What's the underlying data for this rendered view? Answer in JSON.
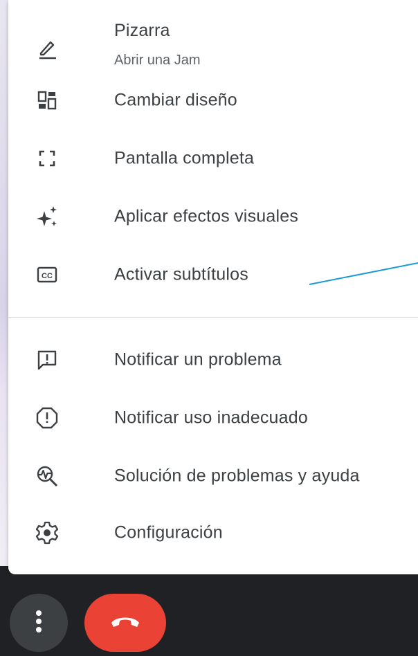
{
  "menu": {
    "items": [
      {
        "label": "Pizarra",
        "sublabel": "Abrir una Jam",
        "icon": "pencil-icon"
      },
      {
        "label": "Cambiar diseño",
        "icon": "layout-icon"
      },
      {
        "label": "Pantalla completa",
        "icon": "fullscreen-icon"
      },
      {
        "label": "Aplicar efectos visuales",
        "icon": "sparkle-icon"
      },
      {
        "label": "Activar subtítulos",
        "icon": "closed-captions-icon"
      },
      {
        "label": "Notificar un problema",
        "icon": "feedback-icon"
      },
      {
        "label": "Notificar uso inadecuado",
        "icon": "report-icon"
      },
      {
        "label": "Solución de problemas y ayuda",
        "icon": "troubleshoot-icon"
      },
      {
        "label": "Configuración",
        "icon": "gear-icon"
      }
    ]
  },
  "controls": {
    "more_options_icon": "more-vert-icon",
    "end_call_icon": "call-end-icon"
  },
  "colors": {
    "menu_bg": "#ffffff",
    "text": "#3c4043",
    "subtext": "#5f6368",
    "end_call": "#ea4335",
    "bottom_bar": "#202124",
    "annotation_line": "#1a9bd7"
  }
}
